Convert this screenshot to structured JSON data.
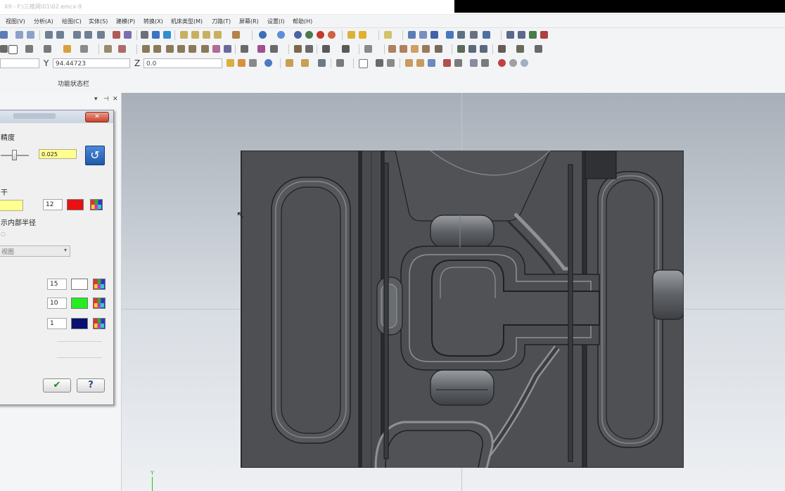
{
  "window": {
    "title": "X9 - F:\\三维网\\01\\02.emcx-9"
  },
  "menu": {
    "items": [
      "视图(V)",
      "分析(A)",
      "绘图(C)",
      "实体(S)",
      "建模(P)",
      "转换(X)",
      "机床类型(M)",
      "刀路(T)",
      "屏幕(R)",
      "设置(I)",
      "帮助(H)"
    ]
  },
  "coords": {
    "y_label": "Y",
    "y_value": "94.44723",
    "z_label": "Z",
    "z_value": "0.0"
  },
  "status": {
    "label": "功能状态栏"
  },
  "panel": {
    "section1_label": "精度",
    "tolerance_value": "0.025",
    "section2_label": "干",
    "field1_value": "12",
    "checkbox_label": "示内部半径",
    "dropdown_value": "视图",
    "row1_value": "15",
    "row2_value": "10",
    "row3_value": "1",
    "ok_symbol": "✔",
    "help_symbol": "?",
    "colors": {
      "field1": "#e81010",
      "row1": "#ffffff",
      "row2": "#22ee22",
      "row3": "#0a1070"
    }
  },
  "viewport": {
    "axis_label": "Y"
  }
}
